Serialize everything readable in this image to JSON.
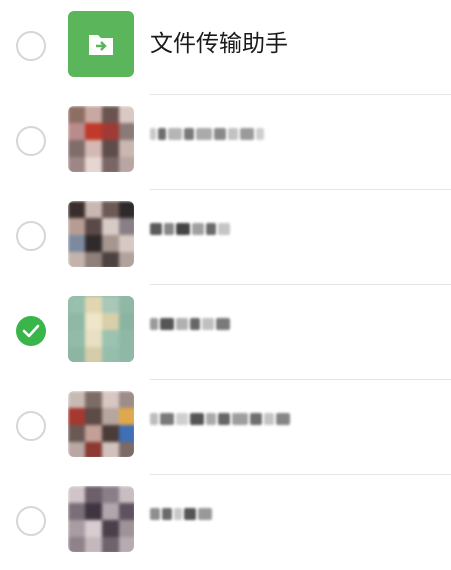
{
  "contacts": [
    {
      "name": "文件传输助手",
      "selected": false,
      "avatar_icon": "file-transfer-icon",
      "accent": "#5bb55a"
    },
    {
      "name": "",
      "selected": false,
      "avatar_icon": "pixelated-avatar",
      "obscured": true
    },
    {
      "name": "",
      "selected": false,
      "avatar_icon": "pixelated-avatar",
      "obscured": true
    },
    {
      "name": "",
      "selected": true,
      "avatar_icon": "pixelated-avatar",
      "obscured": true
    },
    {
      "name": "",
      "selected": false,
      "avatar_icon": "pixelated-avatar",
      "obscured": true
    },
    {
      "name": "",
      "selected": false,
      "avatar_icon": "pixelated-avatar",
      "obscured": true
    }
  ],
  "colors": {
    "check_green": "#39b54a",
    "divider": "#e5e5e5"
  }
}
